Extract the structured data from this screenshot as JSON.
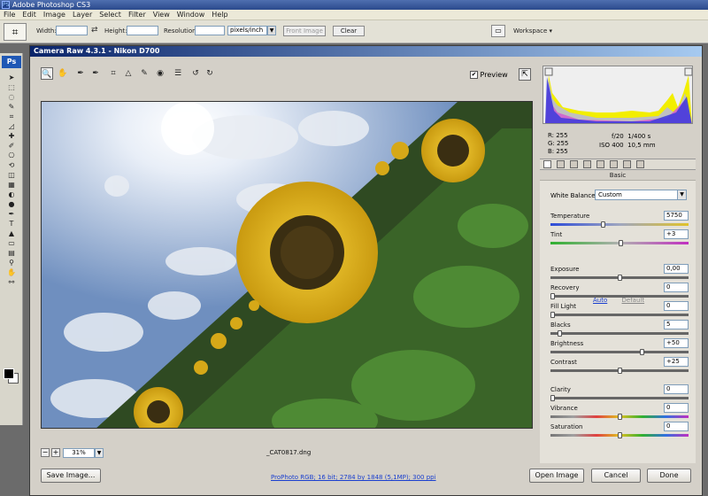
{
  "app": {
    "title": "Adobe Photoshop CS3",
    "logo": "PS",
    "menu": [
      "File",
      "Edit",
      "Image",
      "Layer",
      "Select",
      "Filter",
      "View",
      "Window",
      "Help"
    ]
  },
  "options_bar": {
    "tool_icon": "crop-icon",
    "width_label": "Width:",
    "height_label": "Height:",
    "resolution_label": "Resolution:",
    "unit_value": "pixels/inch",
    "front_image_label": "Front Image",
    "clear_label": "Clear",
    "workspace_label": "Workspace"
  },
  "tools_panel": {
    "logo": "Ps",
    "tools": [
      "move-tool-icon",
      "marquee-tool-icon",
      "lasso-tool-icon",
      "quick-selection-tool-icon",
      "crop-tool-icon",
      "slice-tool-icon",
      "healing-brush-tool-icon",
      "brush-tool-icon",
      "clone-stamp-tool-icon",
      "history-brush-tool-icon",
      "eraser-tool-icon",
      "gradient-tool-icon",
      "blur-tool-icon",
      "dodge-tool-icon",
      "pen-tool-icon",
      "type-tool-icon",
      "path-selection-tool-icon",
      "shape-tool-icon",
      "notes-tool-icon",
      "eyedropper-tool-icon",
      "hand-tool-icon",
      "zoom-tool-icon"
    ],
    "colors": {
      "foreground": "#000000",
      "background": "#ffffff"
    }
  },
  "camera_raw": {
    "title": "Camera Raw 4.3.1  -  Nikon D700",
    "tools": [
      "zoom-tool-icon",
      "hand-tool-icon",
      "white-balance-tool-icon",
      "color-sampler-tool-icon",
      "crop-tool-icon",
      "straighten-tool-icon",
      "spot-removal-tool-icon",
      "red-eye-removal-tool-icon",
      "preferences-icon",
      "rotate-left-icon",
      "rotate-right-icon"
    ],
    "preview_label": "Preview",
    "preview_checked": true,
    "zoom_value": "31%",
    "filename": "_CAT0817.dng",
    "workflow_link": "ProPhoto RGB; 16 bit; 2784 by 1848 (5,1MP); 300 ppi",
    "buttons": {
      "save": "Save Image...",
      "open": "Open Image",
      "cancel": "Cancel",
      "done": "Done"
    },
    "readout": {
      "r": "R:  255",
      "g": "G:  255",
      "b": "B:  255",
      "aperture": "f/20",
      "shutter": "1/400 s",
      "iso": "ISO 400",
      "focal": "10,5 mm"
    },
    "panel": {
      "tabs": [
        "basic-tab-icon",
        "tone-curve-tab-icon",
        "detail-tab-icon",
        "hsl-tab-icon",
        "split-toning-tab-icon",
        "lens-corrections-tab-icon",
        "camera-calibration-tab-icon",
        "presets-tab-icon"
      ],
      "title": "Basic",
      "white_balance_label": "White Balance:",
      "white_balance_value": "Custom",
      "auto_label": "Auto",
      "default_label": "Default",
      "sliders": [
        {
          "label": "Temperature",
          "value": "5750",
          "position": 0.38,
          "track": "temp"
        },
        {
          "label": "Tint",
          "value": "+3",
          "position": 0.51,
          "track": "tint"
        },
        {
          "label": "Exposure",
          "value": "0,00",
          "position": 0.5,
          "track": "gray"
        },
        {
          "label": "Recovery",
          "value": "0",
          "position": 0.0,
          "track": "gray"
        },
        {
          "label": "Fill Light",
          "value": "0",
          "position": 0.0,
          "track": "gray"
        },
        {
          "label": "Blacks",
          "value": "5",
          "position": 0.05,
          "track": "gray"
        },
        {
          "label": "Brightness",
          "value": "+50",
          "position": 0.67,
          "track": "gray"
        },
        {
          "label": "Contrast",
          "value": "+25",
          "position": 0.5,
          "track": "gray"
        },
        {
          "label": "Clarity",
          "value": "0",
          "position": 0.0,
          "track": "gray"
        },
        {
          "label": "Vibrance",
          "value": "0",
          "position": 0.5,
          "track": "rainbow"
        },
        {
          "label": "Saturation",
          "value": "0",
          "position": 0.5,
          "track": "rainbow"
        }
      ]
    }
  }
}
